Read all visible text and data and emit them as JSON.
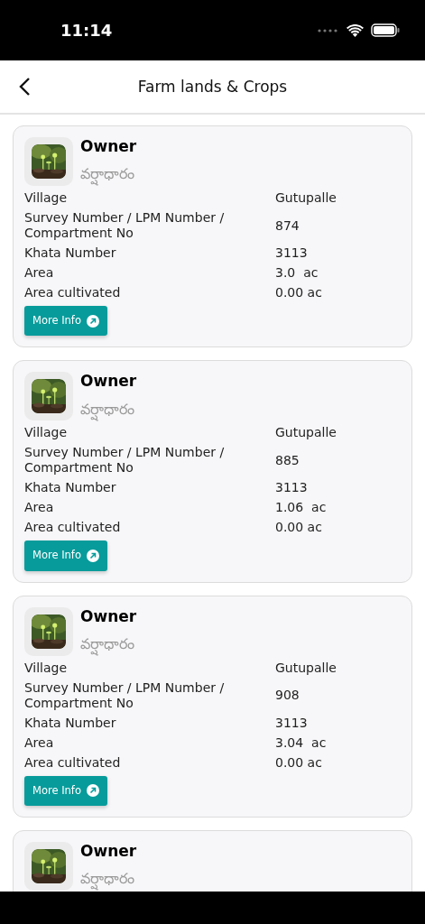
{
  "status_bar": {
    "time": "11:14"
  },
  "header": {
    "title": "Farm lands & Crops"
  },
  "cards": [
    {
      "title": "Owner",
      "subtitle": "వర్షాధారం",
      "rows": [
        {
          "label": "Village",
          "value": "Gutupalle"
        },
        {
          "label": "Survey Number / LPM Number / Compartment No",
          "value": "874"
        },
        {
          "label": "Khata Number",
          "value": "3113"
        },
        {
          "label": "Area",
          "value": "3.0  ac"
        },
        {
          "label": "Area cultivated",
          "value": "0.00 ac"
        }
      ],
      "button": "More Info"
    },
    {
      "title": "Owner",
      "subtitle": "వర్షాధారం",
      "rows": [
        {
          "label": "Village",
          "value": "Gutupalle"
        },
        {
          "label": "Survey Number / LPM Number / Compartment No",
          "value": "885"
        },
        {
          "label": "Khata Number",
          "value": "3113"
        },
        {
          "label": "Area",
          "value": "1.06  ac"
        },
        {
          "label": "Area cultivated",
          "value": "0.00 ac"
        }
      ],
      "button": "More Info"
    },
    {
      "title": "Owner",
      "subtitle": "వర్షాధారం",
      "rows": [
        {
          "label": "Village",
          "value": "Gutupalle"
        },
        {
          "label": "Survey Number / LPM Number / Compartment No",
          "value": "908"
        },
        {
          "label": "Khata Number",
          "value": "3113"
        },
        {
          "label": "Area",
          "value": "3.04  ac"
        },
        {
          "label": "Area cultivated",
          "value": "0.00 ac"
        }
      ],
      "button": "More Info"
    },
    {
      "title": "Owner",
      "subtitle": "వర్షాధారం"
    }
  ]
}
